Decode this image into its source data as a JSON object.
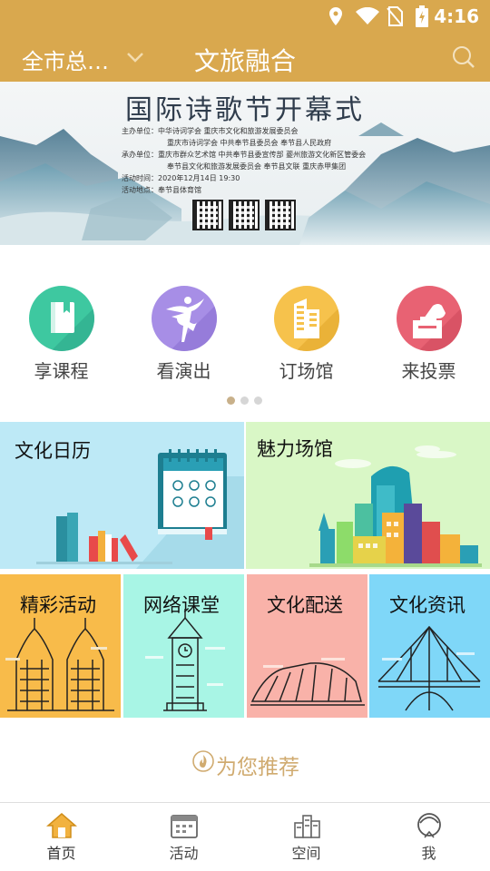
{
  "status_bar": {
    "time": "4:16",
    "icons": [
      "location-icon",
      "wifi-icon",
      "no-sim-icon",
      "battery-icon"
    ]
  },
  "header": {
    "city": "全市总…",
    "title": "文旅融合"
  },
  "banner": {
    "title": "国际诗歌节开幕式",
    "lines": [
      "主办单位：中华诗词学会  重庆市文化和旅游发展委员会",
      "重庆市诗词学会  中共奉节县委员会  奉节县人民政府",
      "承办单位：重庆市群众艺术馆  中共奉节县委宣传部  夔州旅游文化新区管委会",
      "奉节县文化和旅游发展委员会  奉节县文联  重庆赤甲集团",
      "活动时间：2020年12月14日  19:30",
      "活动地点：奉节县体育馆"
    ]
  },
  "quick_entries": [
    {
      "label": "享课程",
      "color": "#3ec8a0",
      "icon": "book-icon"
    },
    {
      "label": "看演出",
      "color": "#a78ee6",
      "icon": "ballet-icon"
    },
    {
      "label": "订场馆",
      "color": "#f6c24c",
      "icon": "building-icon"
    },
    {
      "label": "来投票",
      "color": "#e86273",
      "icon": "vote-icon"
    }
  ],
  "pager": {
    "count": 3,
    "active": 0
  },
  "big_tiles": [
    {
      "label": "文化日历",
      "bg": "#bde9f6"
    },
    {
      "label": "魅力场馆",
      "bg": "#d9f7c6"
    }
  ],
  "small_tiles": [
    {
      "label": "精彩活动",
      "bg": "#f8bb4a"
    },
    {
      "label": "网络课堂",
      "bg": "#a8f5e5"
    },
    {
      "label": "文化配送",
      "bg": "#f9b2a9"
    },
    {
      "label": "文化资讯",
      "bg": "#7fd7f8"
    }
  ],
  "recommend": {
    "label": "为您推荐"
  },
  "tabs": [
    {
      "label": "首页",
      "active": true
    },
    {
      "label": "活动",
      "active": false
    },
    {
      "label": "空间",
      "active": false
    },
    {
      "label": "我",
      "active": false
    }
  ],
  "colors": {
    "brand": "#d9a84e",
    "recommend": "#d0ab70"
  }
}
